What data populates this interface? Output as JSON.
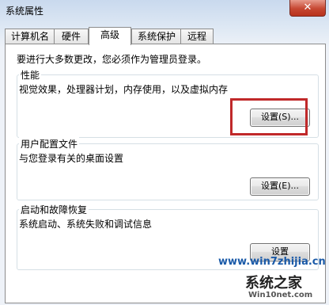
{
  "window": {
    "title": "系统属性",
    "close_glyph": "✕"
  },
  "tabs": [
    {
      "label": "计算机名",
      "active": false
    },
    {
      "label": "硬件",
      "active": false
    },
    {
      "label": "高级",
      "active": true
    },
    {
      "label": "系统保护",
      "active": false
    },
    {
      "label": "远程",
      "active": false
    }
  ],
  "notice": "要进行大多数更改，您必须作为管理员登录。",
  "groups": {
    "performance": {
      "title": "性能",
      "description": "视觉效果，处理器计划，内存使用，以及虚拟内存",
      "button": "设置(S)..."
    },
    "user_profiles": {
      "title": "用户配置文件",
      "description": "与您登录有关的桌面设置",
      "button": "设置(E)..."
    },
    "startup_recovery": {
      "title": "启动和故障恢复",
      "description": "系统启动、系统失败和调试信息",
      "button": "设置"
    }
  },
  "watermark": {
    "site_top": "www.win7zhijia.cn",
    "brand": "系统之家",
    "site_bottom": "Win10net.com"
  },
  "colors": {
    "highlight": "#c0292a",
    "close_button": "#c64732",
    "watermark_blue": "#1a5aa8"
  }
}
